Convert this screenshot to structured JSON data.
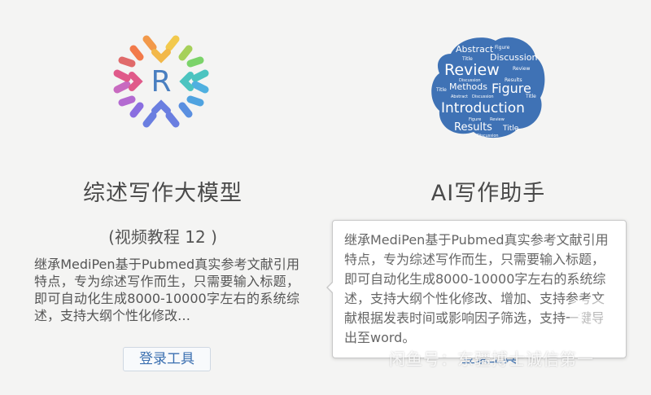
{
  "left_card": {
    "title": "综述写作大模型",
    "subtitle": "(视频教程 12 )",
    "description": "继承MediPen基于Pubmed真实参考文献引用特点，专为综述写作而生，只需要输入标题，即可自动化生成8000-10000字左右的系统综述，支持大纲个性化修改…",
    "login_label": "登录工具",
    "logo_letter": "R",
    "logo_colors": [
      "#f2c94c",
      "#f2994a",
      "#e05a8a",
      "#b36ad1",
      "#6a7ee0",
      "#4fa3e0",
      "#4cc4c0",
      "#7bd36a"
    ]
  },
  "right_card": {
    "title": "AI写作助手",
    "login_label": "登录工具",
    "cloud_words": [
      "Abstract",
      "Figure",
      "Title",
      "Discussion",
      "Review",
      "Discussion",
      "Results",
      "Review",
      "Title",
      "Methods",
      "Figure",
      "Abstract",
      "Discussion",
      "Title",
      "Introduction",
      "Figure",
      "Review",
      "Results",
      "Title",
      "Discussion"
    ],
    "cloud_color": "#3f72b5"
  },
  "tooltip": {
    "text": "继承MediPen基于Pubmed真实参考文献引用特点，专为综述写作而生，只需要输入标题，即可自动化生成8000-10000字左右的系统综述，支持大纲个性化修改、增加、支持参考文献根据发表时间或影响因子筛选，支持一键导出至word。"
  },
  "watermark": {
    "text": "闲鱼号：东疆搏士诚信第一",
    "icon": "chat-bubble-icon"
  }
}
